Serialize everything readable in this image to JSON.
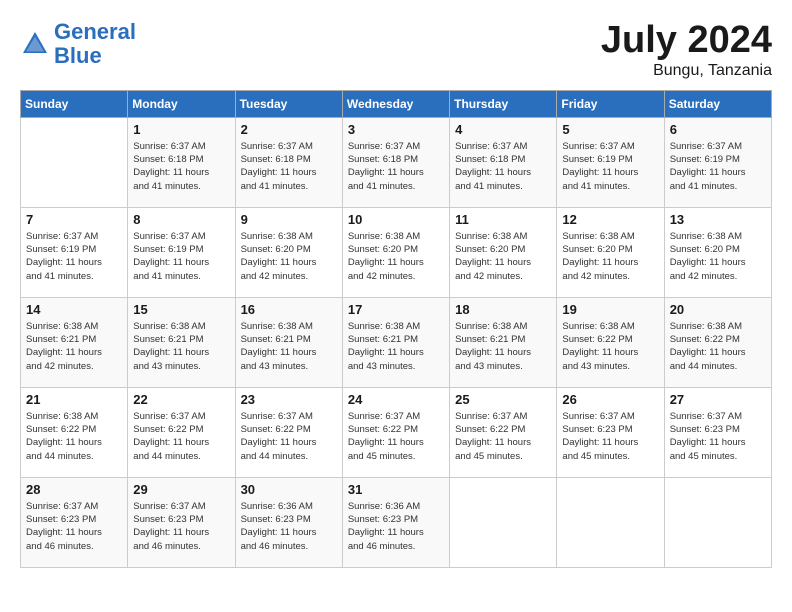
{
  "header": {
    "logo_line1": "General",
    "logo_line2": "Blue",
    "month": "July 2024",
    "location": "Bungu, Tanzania"
  },
  "columns": [
    "Sunday",
    "Monday",
    "Tuesday",
    "Wednesday",
    "Thursday",
    "Friday",
    "Saturday"
  ],
  "weeks": [
    [
      {
        "day": "",
        "info": ""
      },
      {
        "day": "1",
        "info": "Sunrise: 6:37 AM\nSunset: 6:18 PM\nDaylight: 11 hours\nand 41 minutes."
      },
      {
        "day": "2",
        "info": "Sunrise: 6:37 AM\nSunset: 6:18 PM\nDaylight: 11 hours\nand 41 minutes."
      },
      {
        "day": "3",
        "info": "Sunrise: 6:37 AM\nSunset: 6:18 PM\nDaylight: 11 hours\nand 41 minutes."
      },
      {
        "day": "4",
        "info": "Sunrise: 6:37 AM\nSunset: 6:18 PM\nDaylight: 11 hours\nand 41 minutes."
      },
      {
        "day": "5",
        "info": "Sunrise: 6:37 AM\nSunset: 6:19 PM\nDaylight: 11 hours\nand 41 minutes."
      },
      {
        "day": "6",
        "info": "Sunrise: 6:37 AM\nSunset: 6:19 PM\nDaylight: 11 hours\nand 41 minutes."
      }
    ],
    [
      {
        "day": "7",
        "info": "Sunrise: 6:37 AM\nSunset: 6:19 PM\nDaylight: 11 hours\nand 41 minutes."
      },
      {
        "day": "8",
        "info": "Sunrise: 6:37 AM\nSunset: 6:19 PM\nDaylight: 11 hours\nand 41 minutes."
      },
      {
        "day": "9",
        "info": "Sunrise: 6:38 AM\nSunset: 6:20 PM\nDaylight: 11 hours\nand 42 minutes."
      },
      {
        "day": "10",
        "info": "Sunrise: 6:38 AM\nSunset: 6:20 PM\nDaylight: 11 hours\nand 42 minutes."
      },
      {
        "day": "11",
        "info": "Sunrise: 6:38 AM\nSunset: 6:20 PM\nDaylight: 11 hours\nand 42 minutes."
      },
      {
        "day": "12",
        "info": "Sunrise: 6:38 AM\nSunset: 6:20 PM\nDaylight: 11 hours\nand 42 minutes."
      },
      {
        "day": "13",
        "info": "Sunrise: 6:38 AM\nSunset: 6:20 PM\nDaylight: 11 hours\nand 42 minutes."
      }
    ],
    [
      {
        "day": "14",
        "info": "Sunrise: 6:38 AM\nSunset: 6:21 PM\nDaylight: 11 hours\nand 42 minutes."
      },
      {
        "day": "15",
        "info": "Sunrise: 6:38 AM\nSunset: 6:21 PM\nDaylight: 11 hours\nand 43 minutes."
      },
      {
        "day": "16",
        "info": "Sunrise: 6:38 AM\nSunset: 6:21 PM\nDaylight: 11 hours\nand 43 minutes."
      },
      {
        "day": "17",
        "info": "Sunrise: 6:38 AM\nSunset: 6:21 PM\nDaylight: 11 hours\nand 43 minutes."
      },
      {
        "day": "18",
        "info": "Sunrise: 6:38 AM\nSunset: 6:21 PM\nDaylight: 11 hours\nand 43 minutes."
      },
      {
        "day": "19",
        "info": "Sunrise: 6:38 AM\nSunset: 6:22 PM\nDaylight: 11 hours\nand 43 minutes."
      },
      {
        "day": "20",
        "info": "Sunrise: 6:38 AM\nSunset: 6:22 PM\nDaylight: 11 hours\nand 44 minutes."
      }
    ],
    [
      {
        "day": "21",
        "info": "Sunrise: 6:38 AM\nSunset: 6:22 PM\nDaylight: 11 hours\nand 44 minutes."
      },
      {
        "day": "22",
        "info": "Sunrise: 6:37 AM\nSunset: 6:22 PM\nDaylight: 11 hours\nand 44 minutes."
      },
      {
        "day": "23",
        "info": "Sunrise: 6:37 AM\nSunset: 6:22 PM\nDaylight: 11 hours\nand 44 minutes."
      },
      {
        "day": "24",
        "info": "Sunrise: 6:37 AM\nSunset: 6:22 PM\nDaylight: 11 hours\nand 45 minutes."
      },
      {
        "day": "25",
        "info": "Sunrise: 6:37 AM\nSunset: 6:22 PM\nDaylight: 11 hours\nand 45 minutes."
      },
      {
        "day": "26",
        "info": "Sunrise: 6:37 AM\nSunset: 6:23 PM\nDaylight: 11 hours\nand 45 minutes."
      },
      {
        "day": "27",
        "info": "Sunrise: 6:37 AM\nSunset: 6:23 PM\nDaylight: 11 hours\nand 45 minutes."
      }
    ],
    [
      {
        "day": "28",
        "info": "Sunrise: 6:37 AM\nSunset: 6:23 PM\nDaylight: 11 hours\nand 46 minutes."
      },
      {
        "day": "29",
        "info": "Sunrise: 6:37 AM\nSunset: 6:23 PM\nDaylight: 11 hours\nand 46 minutes."
      },
      {
        "day": "30",
        "info": "Sunrise: 6:36 AM\nSunset: 6:23 PM\nDaylight: 11 hours\nand 46 minutes."
      },
      {
        "day": "31",
        "info": "Sunrise: 6:36 AM\nSunset: 6:23 PM\nDaylight: 11 hours\nand 46 minutes."
      },
      {
        "day": "",
        "info": ""
      },
      {
        "day": "",
        "info": ""
      },
      {
        "day": "",
        "info": ""
      }
    ]
  ]
}
